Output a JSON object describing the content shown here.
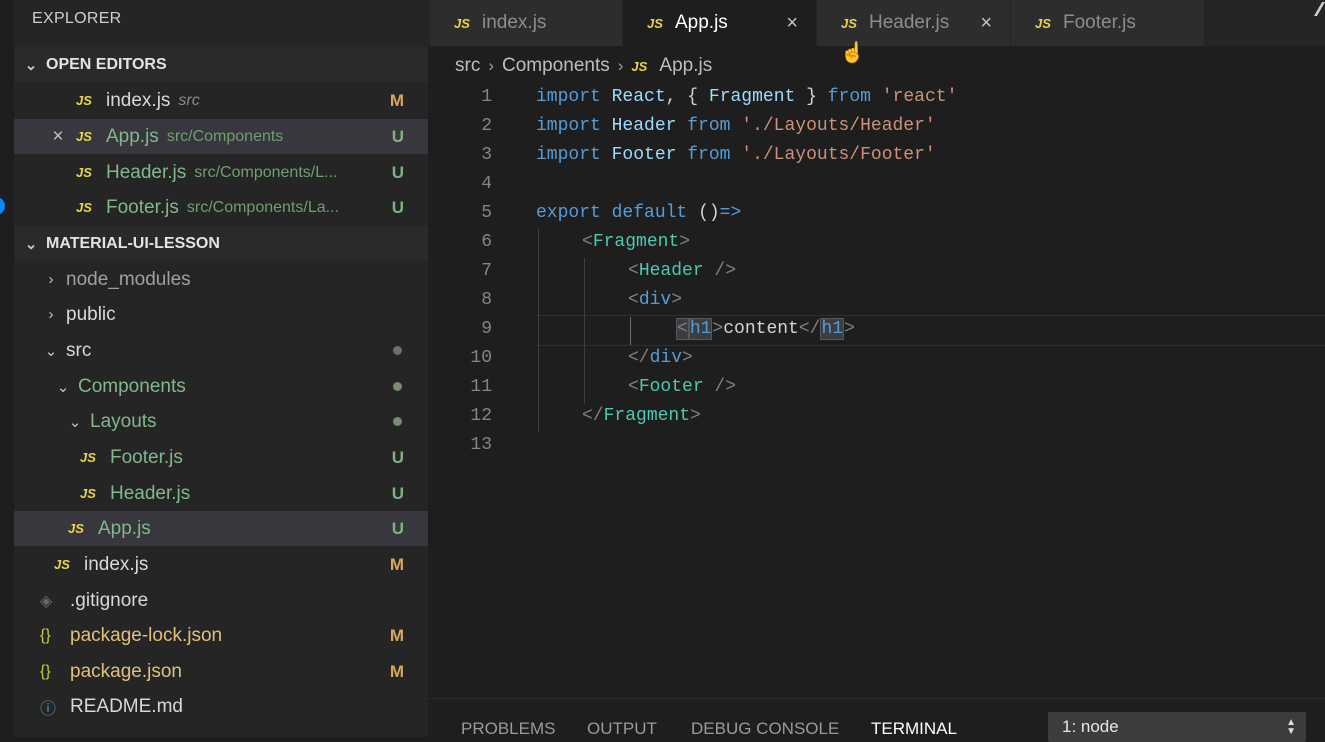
{
  "explorer": {
    "title": "EXPLORER",
    "open_editors": {
      "header": "OPEN EDITORS",
      "items": [
        {
          "icon": "JS",
          "name": "index.js",
          "path": "src",
          "badge": "M"
        },
        {
          "icon": "JS",
          "name": "App.js",
          "path": "src/Components",
          "badge": "U"
        },
        {
          "icon": "JS",
          "name": "Header.js",
          "path": "src/Components/L...",
          "badge": "U"
        },
        {
          "icon": "JS",
          "name": "Footer.js",
          "path": "src/Components/La...",
          "badge": "U"
        }
      ],
      "close_glyph": "×"
    },
    "project": {
      "header": "MATERIAL-UI-LESSON",
      "items": [
        {
          "name": "node_modules"
        },
        {
          "name": "public"
        },
        {
          "name": "src"
        },
        {
          "name": "Components"
        },
        {
          "name": "Layouts"
        },
        {
          "icon": "JS",
          "name": "Footer.js",
          "badge": "U"
        },
        {
          "icon": "JS",
          "name": "Header.js",
          "badge": "U"
        },
        {
          "icon": "JS",
          "name": "App.js",
          "badge": "U"
        },
        {
          "icon": "JS",
          "name": "index.js",
          "badge": "M"
        },
        {
          "icon": "◈",
          "name": ".gitignore"
        },
        {
          "icon": "{}",
          "name": "package-lock.json",
          "badge": "M"
        },
        {
          "icon": "{}",
          "name": "package.json",
          "badge": "M"
        },
        {
          "icon": "ⓘ",
          "name": "README.md"
        }
      ]
    }
  },
  "tabs": [
    {
      "icon": "JS",
      "label": "index.js"
    },
    {
      "icon": "JS",
      "label": "App.js",
      "close": "×"
    },
    {
      "icon": "JS",
      "label": "Header.js",
      "close": "×"
    },
    {
      "icon": "JS",
      "label": "Footer.js"
    }
  ],
  "breadcrumb": {
    "parts": [
      "src",
      "Components",
      "App.js"
    ],
    "icon": "JS",
    "separator": "›"
  },
  "code": {
    "line_numbers": [
      "1",
      "2",
      "3",
      "4",
      "5",
      "6",
      "7",
      "8",
      "9",
      "10",
      "11",
      "12",
      "13"
    ],
    "tokens": {
      "import": "import",
      "from": "from",
      "export": "export",
      "default": "default",
      "react_id": "React",
      "fragment_id": "Fragment",
      "header_id": "Header",
      "footer_id": "Footer",
      "react_str": "'react'",
      "header_str": "'./Layouts/Header'",
      "footer_str": "'./Layouts/Footer'",
      "comma": ",",
      "lbrace": "{",
      "rbrace": "}",
      "arrow_parens": "()",
      "arrow": "=>",
      "lt": "<",
      "gt": ">",
      "lt_slash": "</",
      "self_close": " />",
      "div": "div",
      "h1": "h1",
      "content": "content"
    }
  },
  "panel": {
    "tabs": [
      "PROBLEMS",
      "OUTPUT",
      "DEBUG CONSOLE",
      "TERMINAL"
    ],
    "terminal_select": "1: node"
  }
}
